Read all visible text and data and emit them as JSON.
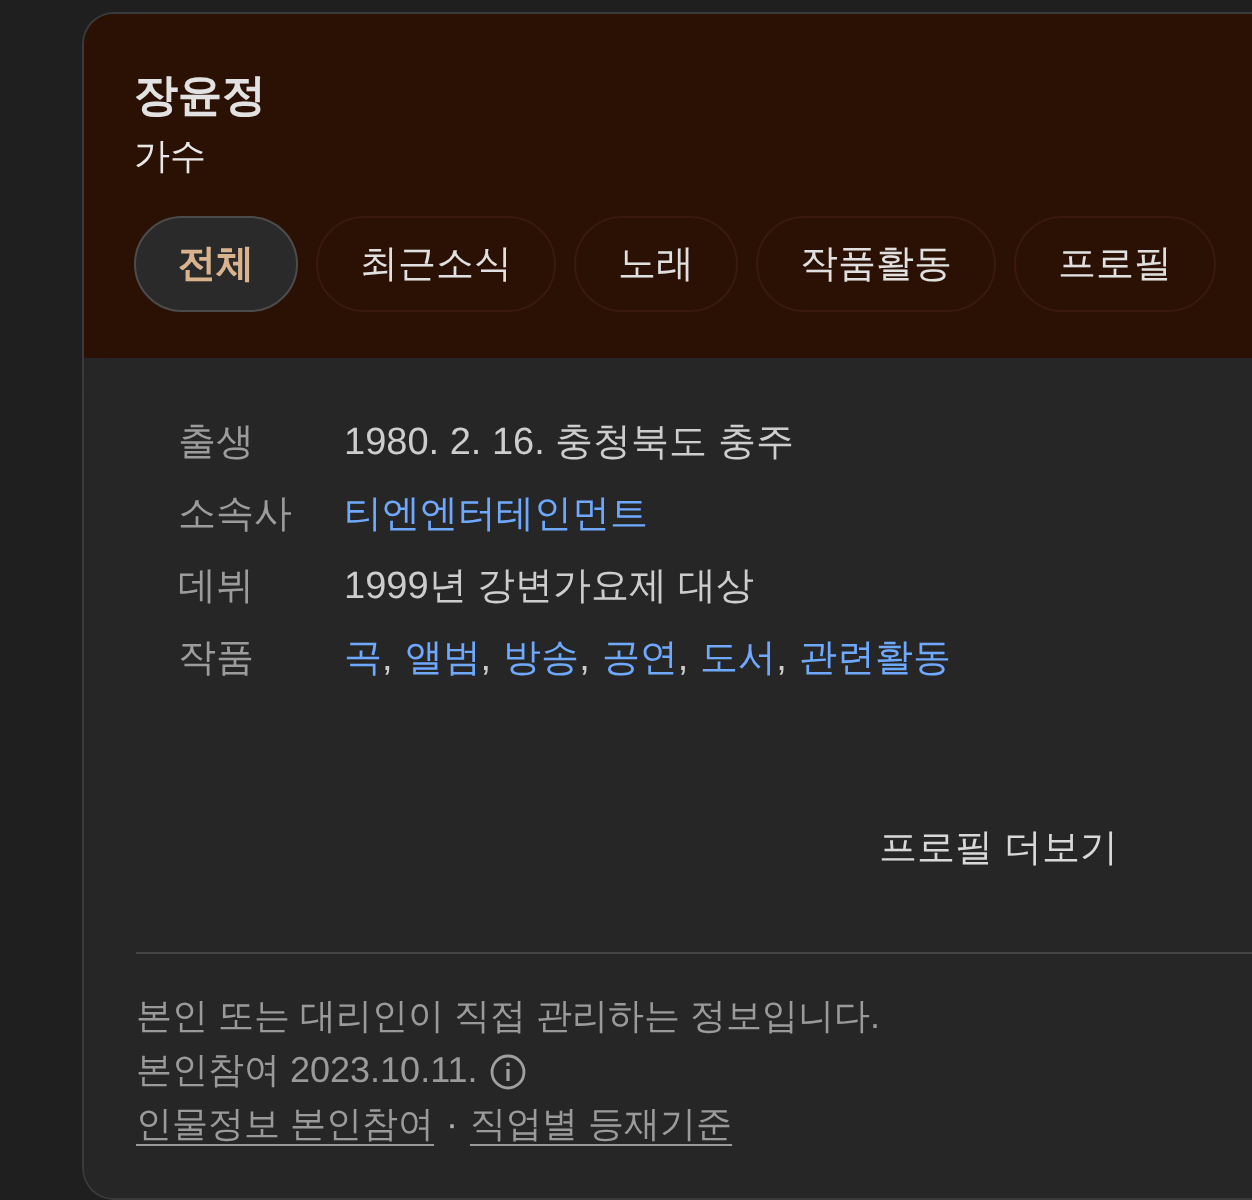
{
  "person": {
    "name": "장윤정",
    "occupation": "가수"
  },
  "tabs": [
    {
      "label": "전체",
      "selected": true
    },
    {
      "label": "최근소식",
      "selected": false
    },
    {
      "label": "노래",
      "selected": false
    },
    {
      "label": "작품활동",
      "selected": false
    },
    {
      "label": "프로필",
      "selected": false
    }
  ],
  "profile": {
    "rows": [
      {
        "label": "출생",
        "kind": "text",
        "value": "1980. 2. 16. 충청북도 충주"
      },
      {
        "label": "소속사",
        "kind": "links",
        "links": [
          "티엔엔터테인먼트"
        ]
      },
      {
        "label": "데뷔",
        "kind": "text",
        "value": "1999년 강변가요제 대상"
      },
      {
        "label": "작품",
        "kind": "links",
        "links": [
          "곡",
          "앨범",
          "방송",
          "공연",
          "도서",
          "관련활동"
        ],
        "separator": ","
      }
    ],
    "more_button": "프로필 더보기"
  },
  "footer": {
    "notice": "본인 또는 대리인이 직접 관리하는 정보입니다.",
    "participation": "본인참여 2023.10.11.",
    "links": [
      "인물정보 본인참여",
      "직업별 등재기준"
    ],
    "separator": "·"
  }
}
